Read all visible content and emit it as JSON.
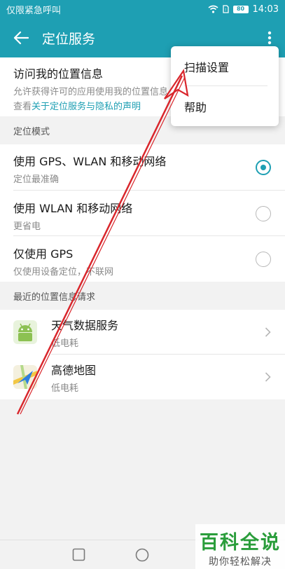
{
  "status_bar": {
    "carrier": "仅限紧急呼叫",
    "battery": "80",
    "time": "14:03"
  },
  "app_bar": {
    "title": "定位服务"
  },
  "my_location": {
    "title": "访问我的位置信息",
    "desc": "允许获得许可的应用使用我的位置信息",
    "link_prefix": "查看",
    "link_text": "关于定位服务与隐私的声明"
  },
  "mode_section": {
    "header": "定位模式",
    "options": [
      {
        "title": "使用 GPS、WLAN 和移动网络",
        "desc": "定位最准确",
        "selected": true
      },
      {
        "title": "使用 WLAN 和移动网络",
        "desc": "更省电",
        "selected": false
      },
      {
        "title": "仅使用 GPS",
        "desc": "仅使用设备定位，不联网",
        "selected": false
      }
    ]
  },
  "recent_section": {
    "header": "最近的位置信息请求",
    "apps": [
      {
        "name": "天气数据服务",
        "desc": "低电耗",
        "icon": "android-icon"
      },
      {
        "name": "高德地图",
        "desc": "低电耗",
        "icon": "amap-icon"
      }
    ]
  },
  "menu": {
    "items": [
      "扫描设置",
      "帮助"
    ]
  },
  "watermark": {
    "line1": "百科全说",
    "line2": "助你轻松解决"
  },
  "colors": {
    "accent": "#1e9fb3",
    "annotation": "#d9262c"
  }
}
